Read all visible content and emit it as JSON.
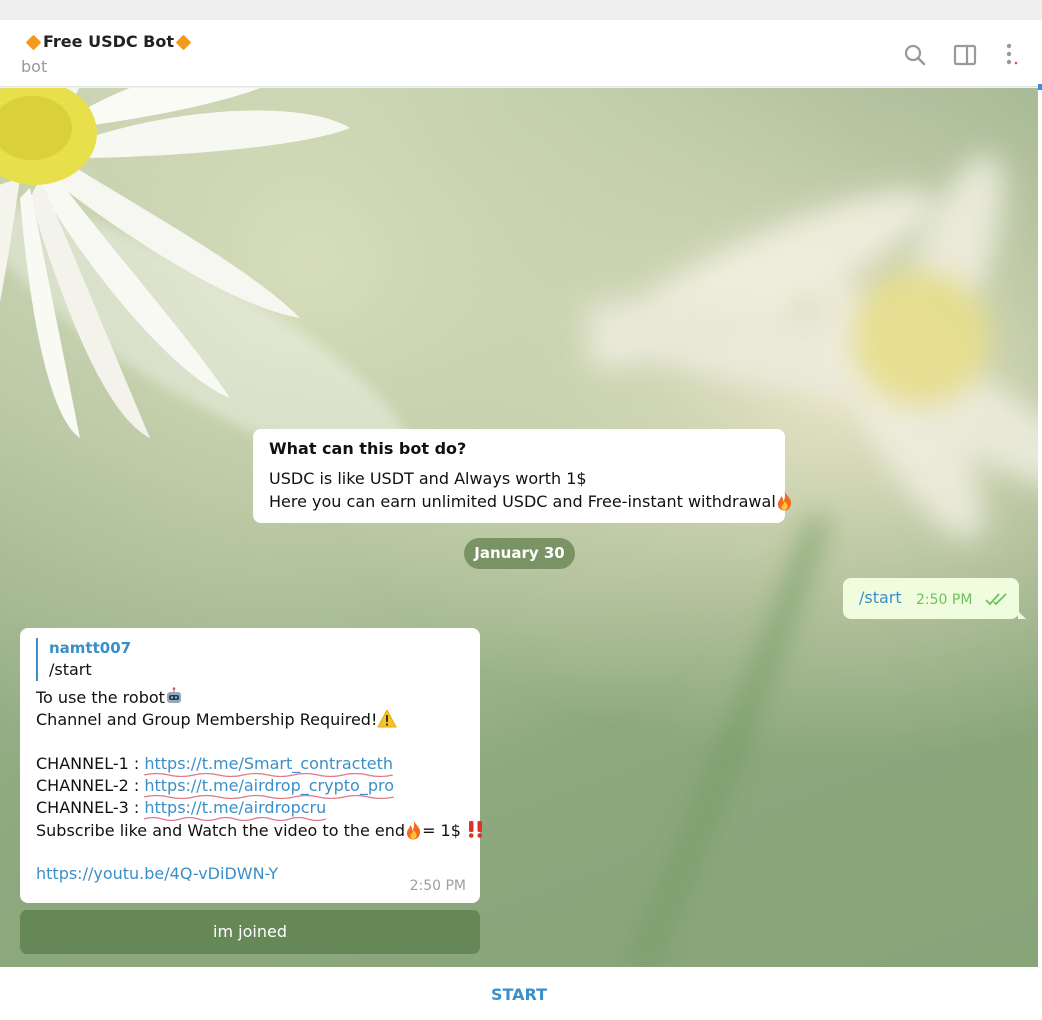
{
  "header": {
    "title": "Free USDC Bot",
    "subtitle": "bot",
    "icons": [
      "search-icon",
      "sidebar-toggle-icon",
      "more-vertical-icon"
    ]
  },
  "info_card": {
    "title": "What can this bot do?",
    "line1": "USDC is like USDT and Always worth 1$",
    "line2": "Here you can earn unlimited USDC and Free-instant withdrawal"
  },
  "date_chip": "January 30",
  "outgoing": {
    "text": "/start",
    "time": "2:50 PM"
  },
  "bot_message": {
    "reply_author": "namtt007",
    "reply_text": "/start",
    "line1": "To use the robot",
    "line2": "Channel and Group Membership Required!",
    "channel1_label": "CHANNEL-1 : ",
    "channel1_link": "https://t.me/Smart_contracteth",
    "channel2_label": "CHANNEL-2 : ",
    "channel2_link": "https://t.me/airdrop_crypto_pro",
    "channel3_label": "CHANNEL-3 : ",
    "channel3_link": "https://t.me/airdropcru",
    "subscribe_a": "Subscribe like and Watch the video to the end",
    "subscribe_b": "= 1$ ",
    "video_link": "https://youtu.be/4Q-vDiDWN-Y",
    "time": "2:50 PM"
  },
  "inline_button": "im joined",
  "bottom_button": "START",
  "colors": {
    "accent": "#3a8fc9",
    "outgoing_bg": "#effdde",
    "diamond": "#f29a1f"
  }
}
